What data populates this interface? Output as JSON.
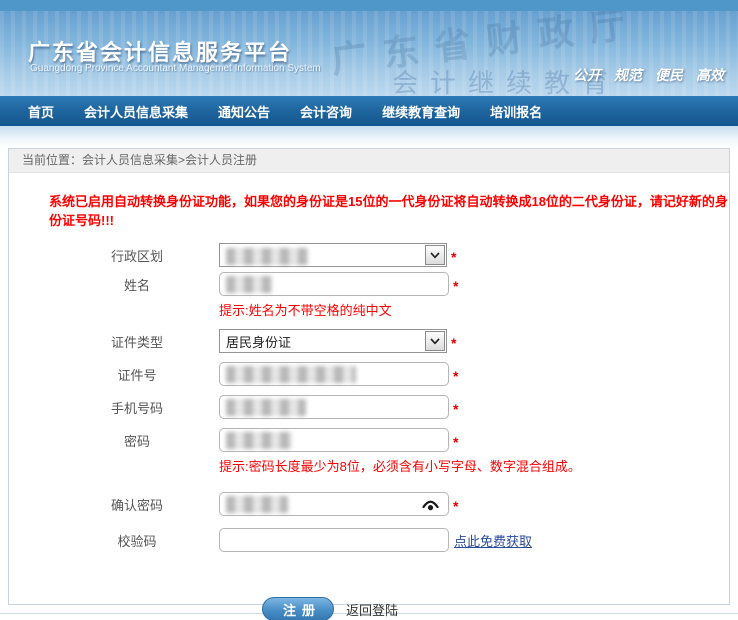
{
  "header": {
    "title": "广东省会计信息服务平台",
    "subtitle": "Guangdong Province Accountant Managemet Information System",
    "slogans": [
      "公开",
      "规范",
      "便民",
      "高效"
    ],
    "watermark_line1": "广东省财政厅",
    "watermark_line2": "会计继续教育"
  },
  "nav": {
    "items": [
      "首页",
      "会计人员信息采集",
      "通知公告",
      "会计咨询",
      "继续教育查询",
      "培训报名"
    ]
  },
  "breadcrumb": {
    "label": "当前位置：",
    "path": "会计人员信息采集>会计人员注册"
  },
  "notice": "系统已启用自动转换身份证功能，如果您的身份证是15位的一代身份证将自动转换成18位的二代身份证，请记好新的身份证号码!!!",
  "form": {
    "required_mark": "*",
    "fields": {
      "region": {
        "label": "行政区划"
      },
      "name": {
        "label": "姓名",
        "hint": "提示:姓名为不带空格的纯中文"
      },
      "id_type": {
        "label": "证件类型",
        "value": "居民身份证"
      },
      "id_number": {
        "label": "证件号"
      },
      "mobile": {
        "label": "手机号码"
      },
      "password": {
        "label": "密码",
        "hint": "提示:密码长度最少为8位，必须含有小写字母、数字混合组成。"
      },
      "confirm_password": {
        "label": "确认密码"
      },
      "captcha": {
        "label": "校验码",
        "link": "点此免费获取"
      }
    },
    "register_button": "注册",
    "back_link": "返回登陆"
  },
  "colors": {
    "nav_blue": "#1d639c",
    "header_blue": "#83b6dc",
    "accent_red": "#ff0000",
    "button_blue": "#3579b3"
  }
}
